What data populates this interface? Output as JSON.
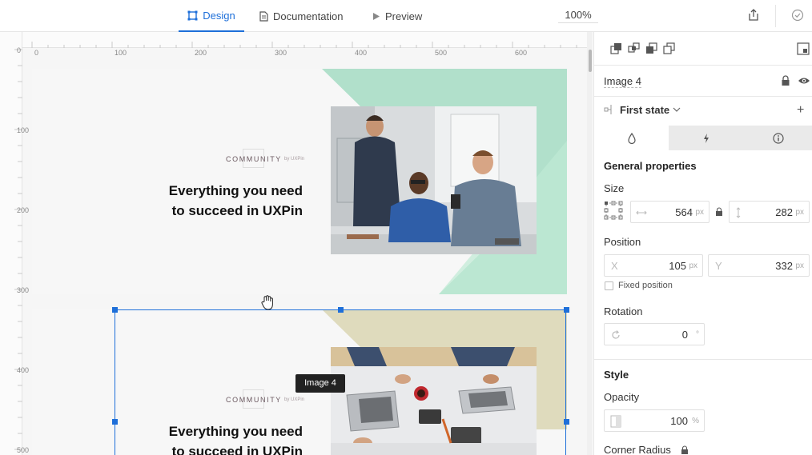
{
  "topbar": {
    "tabs": [
      {
        "label": "Design",
        "icon": "artboard-icon",
        "active": true
      },
      {
        "label": "Documentation",
        "icon": "document-icon",
        "active": false
      },
      {
        "label": "Preview",
        "icon": "play-icon",
        "active": false
      }
    ],
    "zoom": "100%",
    "accent_color": "#1e6fd9"
  },
  "rulers": {
    "top_ticks": [
      "0",
      "100",
      "200",
      "300",
      "400",
      "500",
      "600"
    ],
    "left_ticks": [
      "0",
      "100",
      "200",
      "300",
      "400",
      "500"
    ]
  },
  "canvas": {
    "board1": {
      "community": "COMMUNITY",
      "community_by": "by UXPin",
      "headline_line1": "Everything you need",
      "headline_line2": "to succeed in UXPin",
      "accent_color": "#a9ddc5"
    },
    "board2": {
      "community": "COMMUNITY",
      "community_by": "by UXPin",
      "headline_line1": "Everything you need",
      "headline_line2": "to succeed in UXPin",
      "accent_color": "#dcd7b6"
    },
    "tooltip": "Image 4"
  },
  "panel": {
    "element_name": "Image 4",
    "state": "First state",
    "add_symbol": "+",
    "section_general": "General properties",
    "size_label": "Size",
    "width": "564",
    "height": "282",
    "unit_px": "px",
    "position_label": "Position",
    "x_prefix": "X",
    "y_prefix": "Y",
    "x": "105",
    "y": "332",
    "fixed_position": "Fixed position",
    "rotation_label": "Rotation",
    "rotation": "0",
    "degree_unit": "°",
    "style_heading": "Style",
    "opacity_label": "Opacity",
    "opacity": "100",
    "percent_unit": "%",
    "corner_radius_label": "Corner Radius"
  }
}
